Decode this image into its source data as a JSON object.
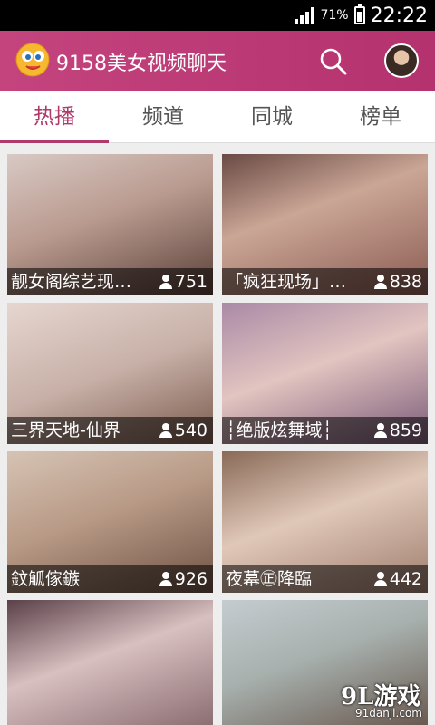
{
  "statusbar": {
    "battery": "71%",
    "time": "22:22"
  },
  "app": {
    "title": "9158美女视频聊天"
  },
  "tabs": [
    {
      "label": "热播",
      "active": true
    },
    {
      "label": "频道",
      "active": false
    },
    {
      "label": "同城",
      "active": false
    },
    {
      "label": "榜单",
      "active": false
    }
  ],
  "rooms": [
    {
      "name": "靓女阁综艺现…",
      "viewers": "751",
      "tone": "#b99a8f"
    },
    {
      "name": "「疯狂现场」…",
      "viewers": "838",
      "tone": "#8b5a52"
    },
    {
      "name": "三界天地-仙界",
      "viewers": "540",
      "tone": "#c7b0a7"
    },
    {
      "name": "┆绝版炫舞域┆",
      "viewers": "859",
      "tone": "#7a5a78"
    },
    {
      "name": "鈫觚傢鏃",
      "viewers": "926",
      "tone": "#b89a86"
    },
    {
      "name": "夜幕㊣降臨",
      "viewers": "442",
      "tone": "#9f7d6e"
    },
    {
      "name": "",
      "viewers": "",
      "tone": "#8c6e73"
    },
    {
      "name": "",
      "viewers": "",
      "tone": "#a7b0ad"
    }
  ],
  "watermark": {
    "brand": "9L游戏",
    "url": "91danji.com"
  },
  "colors": {
    "accent": "#b03a6c",
    "appbar": "#c4447e"
  }
}
